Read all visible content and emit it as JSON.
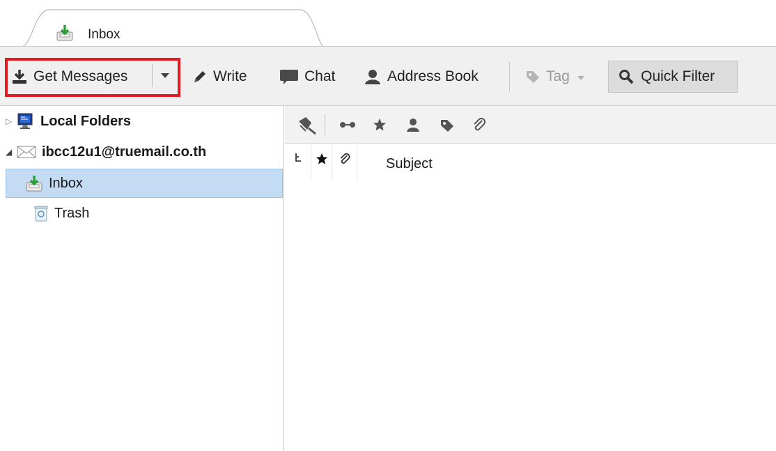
{
  "tab": {
    "label": "Inbox"
  },
  "toolbar": {
    "get_messages": "Get Messages",
    "write": "Write",
    "chat": "Chat",
    "address_book": "Address Book",
    "tag": "Tag",
    "quick_filter": "Quick Filter"
  },
  "folders": {
    "local_folders": "Local Folders",
    "account": "ibcc12u1@truemail.co.th",
    "inbox": "Inbox",
    "trash": "Trash"
  },
  "thread": {
    "subject_header": "Subject"
  },
  "colors": {
    "highlight_box": "#e11b22",
    "selection": "#c3dbf3",
    "toolbar_bg": "#f0f0f0"
  }
}
